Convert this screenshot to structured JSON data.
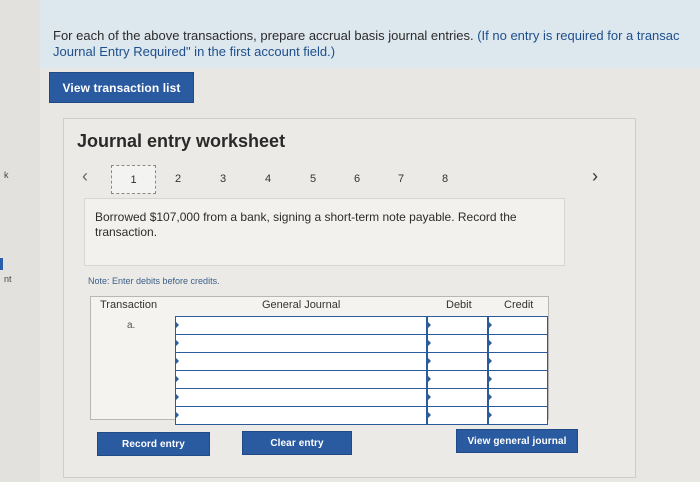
{
  "instructions": {
    "main": "For each of the above transactions, prepare accrual basis journal entries.",
    "parenthetical": "(If no entry is required for a transac",
    "line2": "Journal Entry Required\" in the first account field.)"
  },
  "buttons": {
    "view_transaction_list": "View transaction list",
    "record_entry": "Record entry",
    "clear_entry": "Clear entry",
    "view_general_journal": "View general journal"
  },
  "worksheet": {
    "title": "Journal entry worksheet",
    "steps": [
      "1",
      "2",
      "3",
      "4",
      "5",
      "6",
      "7",
      "8"
    ],
    "active_step": "1",
    "description": "Borrowed $107,000 from a bank, signing a short-term note payable. Record the transaction.",
    "note": "Note: Enter debits before credits."
  },
  "table": {
    "headers": {
      "transaction": "Transaction",
      "general_journal": "General Journal",
      "debit": "Debit",
      "credit": "Credit"
    },
    "rows": [
      {
        "transaction": "a.",
        "account": "",
        "debit": "",
        "credit": ""
      },
      {
        "transaction": "",
        "account": "",
        "debit": "",
        "credit": ""
      },
      {
        "transaction": "",
        "account": "",
        "debit": "",
        "credit": ""
      },
      {
        "transaction": "",
        "account": "",
        "debit": "",
        "credit": ""
      },
      {
        "transaction": "",
        "account": "",
        "debit": "",
        "credit": ""
      },
      {
        "transaction": "",
        "account": "",
        "debit": "",
        "credit": ""
      }
    ]
  },
  "left_edge": {
    "top_text": "k",
    "bottom_text": "nt"
  },
  "colors": {
    "button": "#2a5aa0",
    "input_border": "#2b5b9a",
    "instruction_band": "#dde7ee"
  },
  "icons": {
    "prev": "chevron-left-icon",
    "next": "chevron-right-icon"
  }
}
